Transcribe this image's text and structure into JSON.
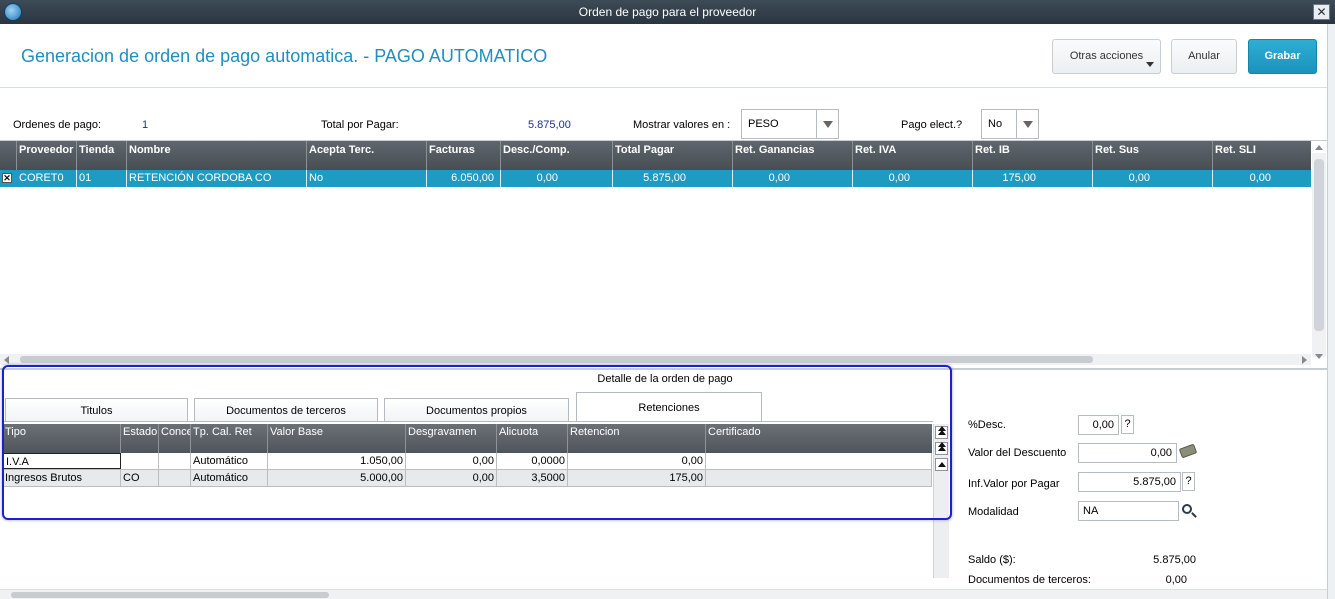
{
  "window": {
    "title": "Orden de pago para el proveedor",
    "close_glyph": "✕"
  },
  "header": {
    "title": "Generacion de orden de pago automatica. - PAGO AUTOMATICO",
    "otras_label": "Otras acciones",
    "anular_label": "Anular",
    "grabar_label": "Grabar"
  },
  "filters": {
    "ordenes_label": "Ordenes de pago:",
    "ordenes_value": "1",
    "total_label": "Total por Pagar:",
    "total_value": "5.875,00",
    "mostrar_label": "Mostrar valores en :",
    "mostrar_value": "PESO",
    "pago_label": "Pago elect.?",
    "pago_value": "No"
  },
  "grid1": {
    "headers": [
      "Proveedor",
      "Tienda",
      "Nombre",
      "Acepta Terc.",
      "Facturas",
      "Desc./Comp.",
      "Total Pagar",
      "Ret. Ganancias",
      "Ret. IVA",
      "Ret. IB",
      "Ret. Sus",
      "Ret. SLI"
    ],
    "row": [
      "CORET0",
      "01",
      "RETENCIÓN CORDOBA CO",
      "No",
      "6.050,00",
      "0,00",
      "5.875,00",
      "0,00",
      "0,00",
      "175,00",
      "0,00",
      "0,00"
    ],
    "row_mark": "✕"
  },
  "detail": {
    "title": "Detalle de la orden de pago",
    "tabs": [
      "Titulos",
      "Documentos de terceros",
      "Documentos propios",
      "Retenciones"
    ],
    "active_tab": "Retenciones",
    "headers": [
      "Tipo",
      "Estado",
      "Conce",
      "Tp. Cal. Ret",
      "Valor Base",
      "Desgravamen",
      "Alicuota",
      "Retencion",
      "Certificado"
    ],
    "rows": [
      [
        "I.V.A",
        "",
        "",
        "Automático",
        "1.050,00",
        "0,00",
        "0,0000",
        "0,00",
        ""
      ],
      [
        "Ingresos Brutos",
        "CO",
        "",
        "Automático",
        "5.000,00",
        "0,00",
        "3,5000",
        "175,00",
        ""
      ]
    ]
  },
  "summary": {
    "desc_pct_label": "%Desc.",
    "desc_pct_value": "0,00",
    "valor_desc_label": "Valor del Descuento",
    "valor_desc_value": "0,00",
    "inf_valor_label": "Inf.Valor por Pagar",
    "inf_valor_value": "5.875,00",
    "modalidad_label": "Modalidad",
    "modalidad_value": "NA",
    "help_glyph": "?",
    "saldo_label": "Saldo ($):",
    "saldo_value": "5.875,00",
    "doc_terceros_label": "Documentos de terceros:",
    "doc_terceros_value": "0,00"
  }
}
